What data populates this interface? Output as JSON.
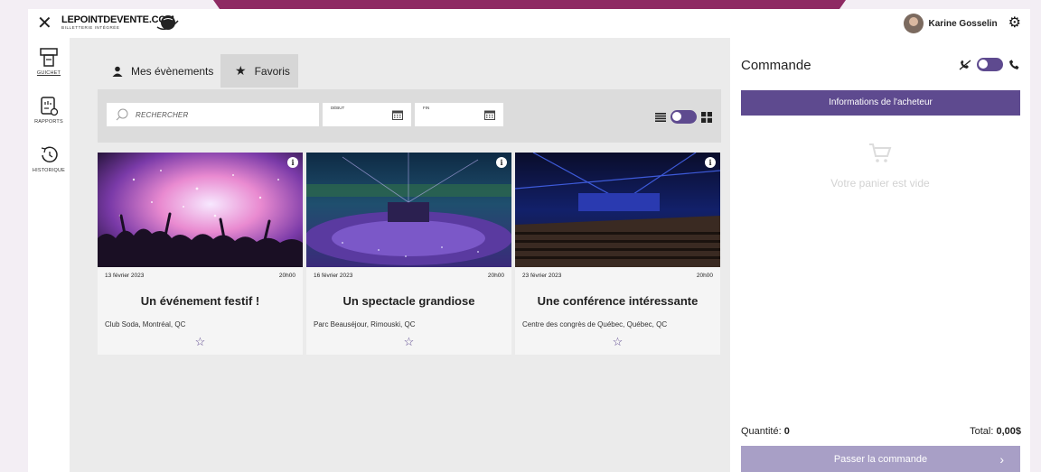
{
  "brand": {
    "logo_main": "LEPOINTDEVENTE.COM",
    "logo_sub": "BILLETTERIE INTÉGRÉE",
    "accent": "#5e4a8f",
    "deco": "#8e2a63"
  },
  "header": {
    "username": "Karine Gosselin",
    "close_icon": "close-icon",
    "settings_icon": "gear-icon"
  },
  "sidebar": {
    "items": [
      {
        "label": "GUICHET",
        "icon": "ticket-icon",
        "active": true
      },
      {
        "label": "RAPPORTS",
        "icon": "report-icon",
        "active": false
      },
      {
        "label": "HISTORIQUE",
        "icon": "history-icon",
        "active": false
      }
    ]
  },
  "tabs": [
    {
      "label": "Mes évènements",
      "icon": "user-icon"
    },
    {
      "label": "Favoris",
      "icon": "star-icon"
    }
  ],
  "filters": {
    "search_placeholder": "RECHERCHER",
    "start_label": "DÉBUT",
    "end_label": "FIN"
  },
  "events": [
    {
      "date": "13 février 2023",
      "time": "20h00",
      "title": "Un événement festif !",
      "venue": "Club Soda, Montréal, QC"
    },
    {
      "date": "16 février 2023",
      "time": "20h00",
      "title": "Un spectacle grandiose",
      "venue": "Parc Beauséjour, Rimouski, QC"
    },
    {
      "date": "23 février 2023",
      "time": "20h00",
      "title": "Une conférence intéressante",
      "venue": "Centre des congrès de Québec, Québec, QC"
    }
  ],
  "order": {
    "title": "Commande",
    "buyer_info": "Informations de l'acheteur",
    "empty": "Votre panier est vide",
    "quantity_label": "Quantité: ",
    "quantity": "0",
    "total_label": "Total: ",
    "total": "0,00$",
    "checkout": "Passer la commande"
  }
}
